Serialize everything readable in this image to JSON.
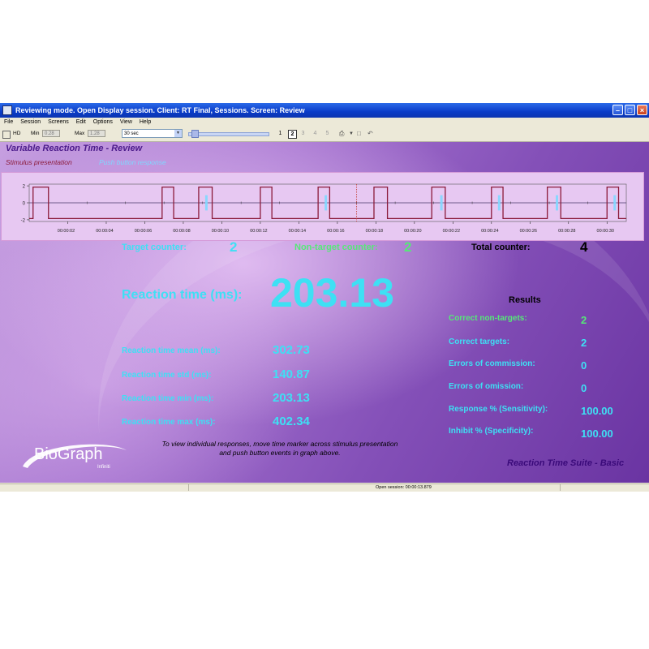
{
  "window": {
    "title": "Reviewing mode. Open Display session. Client: RT Final, Sessions. Screen: Review",
    "menu": [
      "File",
      "Session",
      "Screens",
      "Edit",
      "Options",
      "View",
      "Help"
    ]
  },
  "toolbar": {
    "hd_label": "HD",
    "min_label": "Min",
    "min_value": "0.28",
    "max_label": "Max",
    "max_value": "1.28",
    "duration": "30 sec",
    "pages": [
      "1",
      "2",
      "3",
      "4",
      "5"
    ],
    "active_page": "2"
  },
  "screen": {
    "title": "Variable Reaction Time - Review",
    "legend_stimulus": "Stimulus presentation",
    "legend_push": "Push button response"
  },
  "chart_data": {
    "type": "line",
    "y_ticks": [
      "2",
      "0",
      "-2"
    ],
    "ylim": [
      -2.2,
      2.2
    ],
    "x_ticks": [
      "00:00:02",
      "00:00:04",
      "00:00:06",
      "00:00:08",
      "00:00:10",
      "00:00:12",
      "00:00:14",
      "00:00:16",
      "00:00:18",
      "00:00:20",
      "00:00:22",
      "00:00:24",
      "00:00:26",
      "00:00:28",
      "00:00:30"
    ],
    "xlim": [
      0,
      31
    ],
    "pulses": [
      [
        0.2,
        1.0
      ],
      [
        6.9,
        7.5
      ],
      [
        8.8,
        9.5
      ],
      [
        12.0,
        12.6
      ],
      [
        15.0,
        15.6
      ],
      [
        17.9,
        18.6
      ],
      [
        20.9,
        21.6
      ],
      [
        24.0,
        24.6
      ],
      [
        26.9,
        27.6
      ],
      [
        30.0,
        30.6
      ]
    ],
    "push_markers": [
      9.2,
      15.4,
      21.4,
      24.4,
      27.4,
      30.4
    ],
    "time_marker": 17.0,
    "series": [
      {
        "name": "Stimulus presentation",
        "color": "#8b1a3a"
      },
      {
        "name": "Push button response",
        "color": "#7fd8ff"
      }
    ]
  },
  "counters": {
    "target_label": "Target counter:",
    "target_value": "2",
    "nontarget_label": "Non-target counter:",
    "nontarget_value": "2",
    "total_label": "Total counter:",
    "total_value": "4"
  },
  "reaction": {
    "label": "Reaction time (ms):",
    "value": "203.13"
  },
  "stats": [
    {
      "label": "Reaction time mean (ms):",
      "value": "302.73"
    },
    {
      "label": "Reaction time std (ms):",
      "value": "140.87"
    },
    {
      "label": "Reaction time min (ms):",
      "value": "203.13"
    },
    {
      "label": "Reaction time max (ms):",
      "value": "402.34"
    }
  ],
  "results": {
    "heading": "Results",
    "rows": [
      {
        "label": "Correct non-targets:",
        "value": "2"
      },
      {
        "label": "Correct targets:",
        "value": "2"
      },
      {
        "label": "Errors of commission:",
        "value": "0"
      },
      {
        "label": "Errors of omission:",
        "value": "0"
      },
      {
        "label": "Response % (Sensitivity):",
        "value": "100.00"
      },
      {
        "label": "Inhibit % (Specificity):",
        "value": "100.00"
      }
    ]
  },
  "instruction": {
    "line1": "To view individual responses, move time marker across stimulus presentation",
    "line2": "and push button events in graph above."
  },
  "branding": {
    "logo": "BioGraph",
    "logo_sub": "Infiniti",
    "suite": "Reaction Time Suite - Basic"
  },
  "status": {
    "text": "Open session: 00:00:13.879"
  }
}
